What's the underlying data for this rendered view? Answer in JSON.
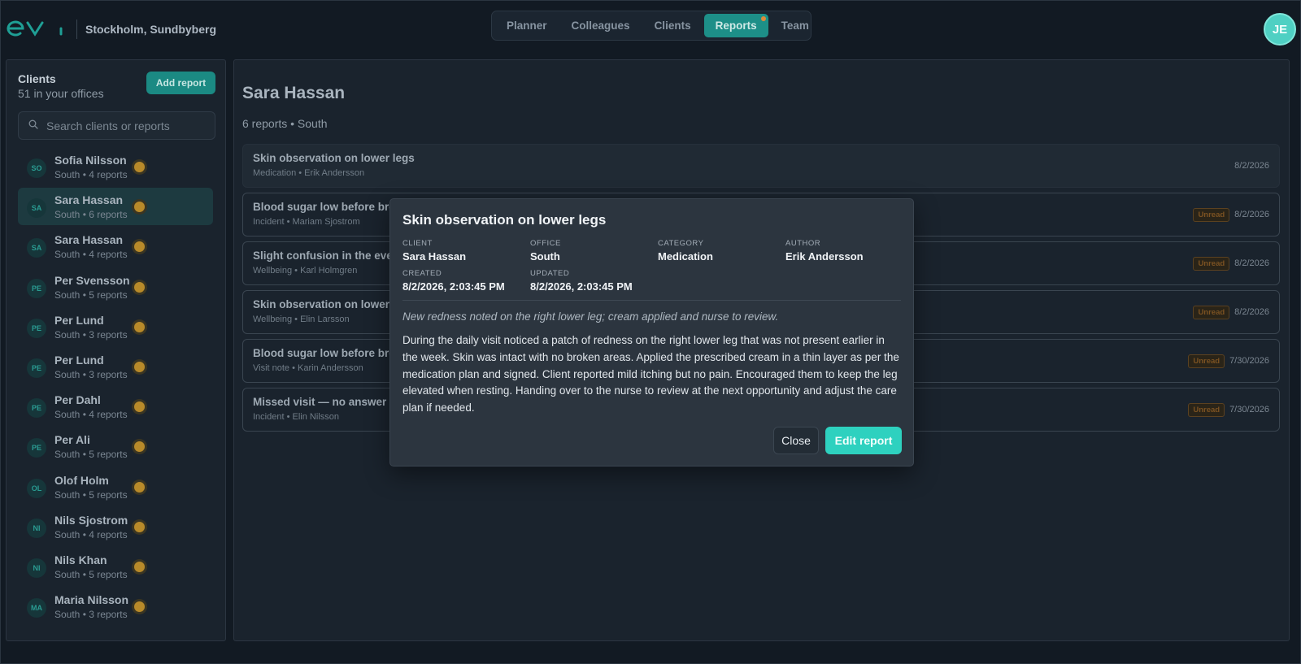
{
  "header": {
    "logo_text": "eva",
    "location": "Stockholm, Sundbyberg",
    "nav": [
      {
        "label": "Planner",
        "active": false,
        "dot": false
      },
      {
        "label": "Colleagues",
        "active": false,
        "dot": false
      },
      {
        "label": "Clients",
        "active": false,
        "dot": false
      },
      {
        "label": "Reports",
        "active": true,
        "dot": true
      },
      {
        "label": "Team",
        "active": false,
        "dot": false
      }
    ],
    "user_initials": "JE"
  },
  "sidebar": {
    "title": "Clients",
    "subtitle": "51 in your offices",
    "add_button": "Add report",
    "search_placeholder": "Search clients or reports",
    "clients": [
      {
        "initials": "SO",
        "name": "Sofia Nilsson",
        "meta": "South • 4 reports",
        "selected": false
      },
      {
        "initials": "SA",
        "name": "Sara Hassan",
        "meta": "South • 6 reports",
        "selected": true
      },
      {
        "initials": "SA",
        "name": "Sara Hassan",
        "meta": "South • 4 reports",
        "selected": false
      },
      {
        "initials": "PE",
        "name": "Per Svensson",
        "meta": "South • 5 reports",
        "selected": false
      },
      {
        "initials": "PE",
        "name": "Per Lund",
        "meta": "South • 3 reports",
        "selected": false
      },
      {
        "initials": "PE",
        "name": "Per Lund",
        "meta": "South • 3 reports",
        "selected": false
      },
      {
        "initials": "PE",
        "name": "Per Dahl",
        "meta": "South • 4 reports",
        "selected": false
      },
      {
        "initials": "PE",
        "name": "Per Ali",
        "meta": "South • 5 reports",
        "selected": false
      },
      {
        "initials": "OL",
        "name": "Olof Holm",
        "meta": "South • 5 reports",
        "selected": false
      },
      {
        "initials": "NI",
        "name": "Nils Sjostrom",
        "meta": "South • 4 reports",
        "selected": false
      },
      {
        "initials": "NI",
        "name": "Nils Khan",
        "meta": "South • 5 reports",
        "selected": false
      },
      {
        "initials": "MA",
        "name": "Maria Nilsson",
        "meta": "South • 3 reports",
        "selected": false
      }
    ]
  },
  "main": {
    "title": "Sara Hassan",
    "subtitle": "6 reports • South",
    "reports": [
      {
        "title": "Skin observation on lower legs",
        "meta": "Medication • Erik Andersson",
        "date": "8/2/2026",
        "unread": false
      },
      {
        "title": "Blood sugar low before bre",
        "meta": "Incident • Mariam Sjostrom",
        "date": "8/2/2026",
        "unread": true
      },
      {
        "title": "Slight confusion in the eve",
        "meta": "Wellbeing • Karl Holmgren",
        "date": "8/2/2026",
        "unread": true
      },
      {
        "title": "Skin observation on lower l",
        "meta": "Wellbeing • Elin Larsson",
        "date": "8/2/2026",
        "unread": true
      },
      {
        "title": "Blood sugar low before bre",
        "meta": "Visit note • Karin Andersson",
        "date": "7/30/2026",
        "unread": true
      },
      {
        "title": "Missed visit — no answer",
        "meta": "Incident • Elin Nilsson",
        "date": "7/30/2026",
        "unread": true
      }
    ],
    "unread_label": "Unread"
  },
  "modal": {
    "title": "Skin observation on lower legs",
    "fields": {
      "client_label": "CLIENT",
      "client": "Sara Hassan",
      "office_label": "OFFICE",
      "office": "South",
      "category_label": "CATEGORY",
      "category": "Medication",
      "author_label": "AUTHOR",
      "author": "Erik Andersson",
      "created_label": "CREATED",
      "created": "8/2/2026, 2:03:45 PM",
      "updated_label": "UPDATED",
      "updated": "8/2/2026, 2:03:45 PM"
    },
    "summary": "New redness noted on the right lower leg; cream applied and nurse to review.",
    "body": "During the daily visit noticed a patch of redness on the right lower leg that was not present earlier in the week. Skin was intact with no broken areas. Applied the prescribed cream in a thin layer as per the medication plan and signed. Client reported mild itching but no pain. Encouraged them to keep the leg elevated when resting. Handing over to the nurse to review at the next opportunity and adjust the care plan if needed.",
    "close_label": "Close",
    "edit_label": "Edit report"
  },
  "colors": {
    "accent": "#2ed1bf",
    "accent_dim": "#1b8a83",
    "background": "#121a23",
    "panel": "#1a232d",
    "modal": "#2c353f",
    "status_dot": "#b88a2a",
    "unread": "#7b5222"
  },
  "icons": {
    "search": "search-icon"
  }
}
